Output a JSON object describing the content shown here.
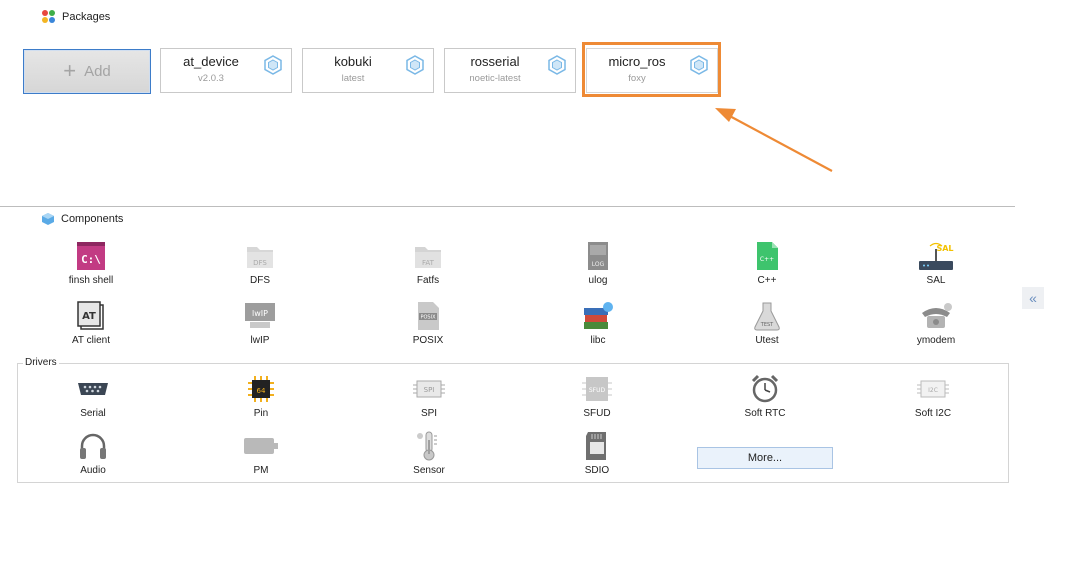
{
  "packages": {
    "title": "Packages",
    "add_label": "Add",
    "items": [
      {
        "name": "at_device",
        "version": "v2.0.3"
      },
      {
        "name": "kobuki",
        "version": "latest"
      },
      {
        "name": "rosserial",
        "version": "noetic-latest"
      },
      {
        "name": "micro_ros",
        "version": "foxy"
      }
    ]
  },
  "components": {
    "title": "Components",
    "items": [
      {
        "label": "finsh shell",
        "icon": "terminal-icon"
      },
      {
        "label": "DFS",
        "icon": "folder-icon"
      },
      {
        "label": "Fatfs",
        "icon": "fat-folder-icon"
      },
      {
        "label": "ulog",
        "icon": "log-file-icon"
      },
      {
        "label": "C++",
        "icon": "cpp-file-icon"
      },
      {
        "label": "SAL",
        "icon": "router-icon"
      },
      {
        "label": "AT client",
        "icon": "at-icon"
      },
      {
        "label": "lwIP",
        "icon": "lwip-board-icon"
      },
      {
        "label": "POSIX",
        "icon": "posix-file-icon"
      },
      {
        "label": "libc",
        "icon": "books-icon"
      },
      {
        "label": "Utest",
        "icon": "flask-icon"
      },
      {
        "label": "ymodem",
        "icon": "phone-icon"
      }
    ]
  },
  "drivers": {
    "title": "Drivers",
    "items": [
      {
        "label": "Serial",
        "icon": "serial-port-icon"
      },
      {
        "label": "Pin",
        "icon": "chip-icon"
      },
      {
        "label": "SPI",
        "icon": "spi-chip-icon"
      },
      {
        "label": "SFUD",
        "icon": "sfud-chip-icon"
      },
      {
        "label": "Soft RTC",
        "icon": "alarm-clock-icon"
      },
      {
        "label": "Soft I2C",
        "icon": "i2c-chip-icon"
      },
      {
        "label": "Audio",
        "icon": "headphones-icon"
      },
      {
        "label": "PM",
        "icon": "battery-icon"
      },
      {
        "label": "Sensor",
        "icon": "thermometer-icon"
      },
      {
        "label": "SDIO",
        "icon": "sd-card-icon"
      }
    ],
    "more_label": "More..."
  },
  "collapse_label": "«",
  "colors": {
    "accent": "#3d7cc9",
    "highlight": "#ee8a35"
  }
}
